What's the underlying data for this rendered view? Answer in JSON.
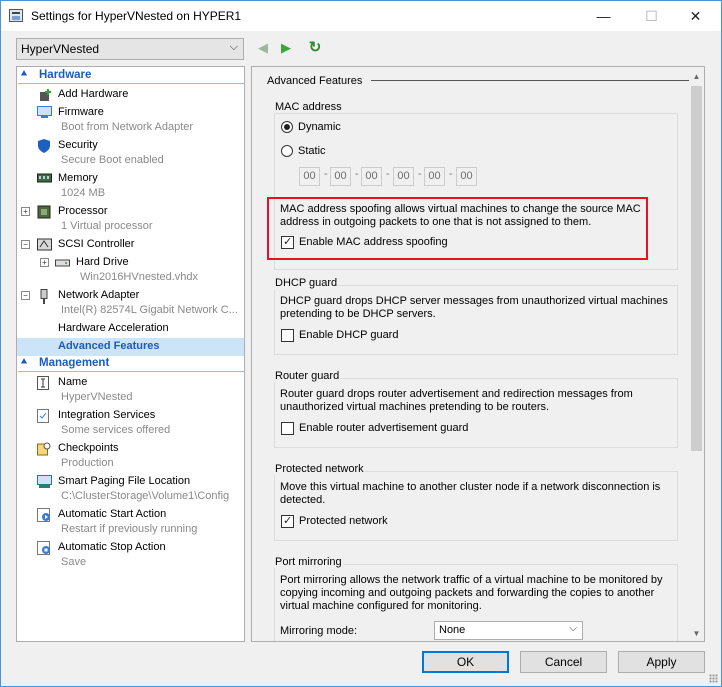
{
  "window": {
    "title": "Settings for HyperVNested on HYPER1",
    "minimize": "—",
    "maximize": "☐",
    "close": "✕"
  },
  "toolbar": {
    "vm_selected": "HyperVNested",
    "vm_arrow": "⌵",
    "back": "◀",
    "forward": "▶",
    "refresh": "↻"
  },
  "tree": {
    "hardware_label": "Hardware",
    "management_label": "Management",
    "hardware_items": [
      {
        "name": "Add Hardware",
        "sub": ""
      },
      {
        "name": "Firmware",
        "sub": "Boot from Network Adapter"
      },
      {
        "name": "Security",
        "sub": "Secure Boot enabled"
      },
      {
        "name": "Memory",
        "sub": "1024 MB"
      },
      {
        "name": "Processor",
        "sub": "1 Virtual processor"
      },
      {
        "name": "SCSI Controller",
        "sub": ""
      },
      {
        "name": "Hard Drive",
        "sub": "Win2016HVnested.vhdx"
      },
      {
        "name": "Network Adapter",
        "sub": "Intel(R) 82574L Gigabit Network C..."
      },
      {
        "name": "Hardware Acceleration",
        "sub": ""
      },
      {
        "name": "Advanced Features",
        "sub": ""
      }
    ],
    "management_items": [
      {
        "name": "Name",
        "sub": "HyperVNested"
      },
      {
        "name": "Integration Services",
        "sub": "Some services offered"
      },
      {
        "name": "Checkpoints",
        "sub": "Production"
      },
      {
        "name": "Smart Paging File Location",
        "sub": "C:\\ClusterStorage\\Volume1\\Config"
      },
      {
        "name": "Automatic Start Action",
        "sub": "Restart if previously running"
      },
      {
        "name": "Automatic Stop Action",
        "sub": "Save"
      }
    ]
  },
  "panel": {
    "title": "Advanced Features",
    "mac": {
      "group_label": "MAC address",
      "dynamic_label": "Dynamic",
      "static_label": "Static",
      "octets": [
        "00",
        "00",
        "00",
        "00",
        "00",
        "00"
      ],
      "spoof_description": "MAC address spoofing allows virtual machines to change the source MAC address in outgoing packets to one that is not assigned to them.",
      "spoof_label": "Enable MAC address spoofing"
    },
    "dhcp": {
      "group_label": "DHCP guard",
      "description": "DHCP guard drops DHCP server messages from unauthorized virtual machines pretending to be DHCP servers.",
      "checkbox_label": "Enable DHCP guard"
    },
    "router": {
      "group_label": "Router guard",
      "description": "Router guard drops router advertisement and redirection messages from unauthorized virtual machines pretending to be routers.",
      "checkbox_label": "Enable router advertisement guard"
    },
    "protected": {
      "group_label": "Protected network",
      "description": "Move this virtual machine to another cluster node if a network disconnection is detected.",
      "checkbox_label": "Protected network"
    },
    "mirroring": {
      "group_label": "Port mirroring",
      "description": "Port mirroring allows the network traffic of a virtual machine to be monitored by copying incoming and outgoing packets and forwarding the copies to another virtual machine configured for monitoring.",
      "mode_label": "Mirroring mode:",
      "mode_value": "None",
      "mode_arrow": "⌵"
    }
  },
  "buttons": {
    "ok": "OK",
    "cancel": "Cancel",
    "apply": "Apply"
  },
  "colors": {
    "accent": "#1b5bbd",
    "highlight_border": "#e81123",
    "selection": "#cce4f7",
    "ok_border": "#0078d7"
  }
}
